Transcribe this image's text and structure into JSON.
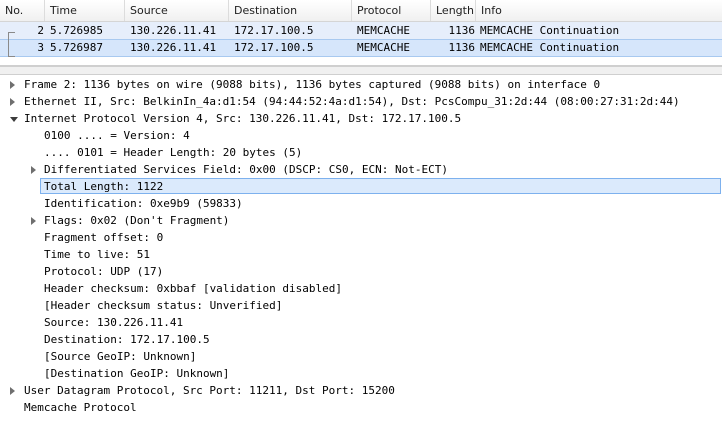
{
  "packet_list": {
    "columns": [
      "No.",
      "Time",
      "Source",
      "Destination",
      "Protocol",
      "Length",
      "Info"
    ],
    "rows": [
      {
        "no": "2",
        "time": "5.726985",
        "source": "130.226.11.41",
        "destination": "172.17.100.5",
        "protocol": "MEMCACHE",
        "length": "1136",
        "info": "MEMCACHE Continuation"
      },
      {
        "no": "3",
        "time": "5.726987",
        "source": "130.226.11.41",
        "destination": "172.17.100.5",
        "protocol": "MEMCACHE",
        "length": "1136",
        "info": "MEMCACHE Continuation"
      }
    ]
  },
  "details": [
    {
      "text": "Frame 2: 1136 bytes on wire (9088 bits), 1136 bytes captured (9088 bits) on interface 0",
      "level": 0,
      "arrow": "collapsed"
    },
    {
      "text": "Ethernet II, Src: BelkinIn_4a:d1:54 (94:44:52:4a:d1:54), Dst: PcsCompu_31:2d:44 (08:00:27:31:2d:44)",
      "level": 0,
      "arrow": "collapsed"
    },
    {
      "text": "Internet Protocol Version 4, Src: 130.226.11.41, Dst: 172.17.100.5",
      "level": 0,
      "arrow": "expanded"
    },
    {
      "text": "0100 .... = Version: 4",
      "level": 1,
      "arrow": "none"
    },
    {
      "text": ".... 0101 = Header Length: 20 bytes (5)",
      "level": 1,
      "arrow": "none"
    },
    {
      "text": "Differentiated Services Field: 0x00 (DSCP: CS0, ECN: Not-ECT)",
      "level": 1,
      "arrow": "collapsed"
    },
    {
      "text": "Total Length: 1122",
      "level": 1,
      "arrow": "none",
      "selected": true
    },
    {
      "text": "Identification: 0xe9b9 (59833)",
      "level": 1,
      "arrow": "none"
    },
    {
      "text": "Flags: 0x02 (Don't Fragment)",
      "level": 1,
      "arrow": "collapsed"
    },
    {
      "text": "Fragment offset: 0",
      "level": 1,
      "arrow": "none"
    },
    {
      "text": "Time to live: 51",
      "level": 1,
      "arrow": "none"
    },
    {
      "text": "Protocol: UDP (17)",
      "level": 1,
      "arrow": "none"
    },
    {
      "text": "Header checksum: 0xbbaf [validation disabled]",
      "level": 1,
      "arrow": "none"
    },
    {
      "text": "[Header checksum status: Unverified]",
      "level": 1,
      "arrow": "none"
    },
    {
      "text": "Source: 130.226.11.41",
      "level": 1,
      "arrow": "none"
    },
    {
      "text": "Destination: 172.17.100.5",
      "level": 1,
      "arrow": "none"
    },
    {
      "text": "[Source GeoIP: Unknown]",
      "level": 1,
      "arrow": "none"
    },
    {
      "text": "[Destination GeoIP: Unknown]",
      "level": 1,
      "arrow": "none"
    },
    {
      "text": "User Datagram Protocol, Src Port: 11211, Dst Port: 15200",
      "level": 0,
      "arrow": "collapsed"
    },
    {
      "text": "Memcache Protocol",
      "level": 0,
      "arrow": "none"
    }
  ]
}
